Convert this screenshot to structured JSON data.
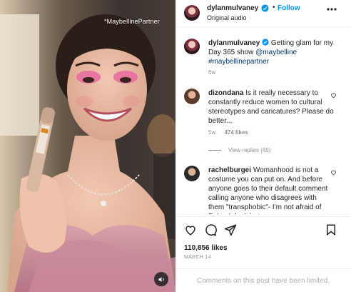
{
  "post": {
    "username": "dylanmulvaney",
    "separator": "•",
    "follow_label": "Follow",
    "audio_label": "Original audio",
    "more_icon": "more-horizontal-icon",
    "verified_icon": "verified-badge-icon"
  },
  "media": {
    "partner_tag": "*MaybellinePartner",
    "audio_icon": "speaker-icon"
  },
  "caption": {
    "username": "dylanmulvaney",
    "text": "Getting glam for my Day 365 show",
    "mention": "@maybelline",
    "hashtag": "#maybellinepartner",
    "time": "6w"
  },
  "comments": [
    {
      "username": "dizondana",
      "text": "Is it really necessary to constantly reduce women to cultural stereotypes and caricatures? Please do better...",
      "time": "5w",
      "likes": "474 likes",
      "view_replies": "View replies (45)"
    },
    {
      "username": "rachelburgei",
      "text": "Womanhood is not a costume you can put on. And before anyone goes to their default comment calling anyone who disagrees with them \"transphobic\"- I'm not afraid of Dylan I don't hate"
    }
  ],
  "actions": {
    "like_icon": "heart-icon",
    "comment_icon": "comment-icon",
    "share_icon": "share-icon",
    "save_icon": "bookmark-icon"
  },
  "stats": {
    "likes": "110,856 likes",
    "date": "MARCH 14"
  },
  "footer": {
    "comments_limited": "Comments on this post have been limited."
  },
  "colors": {
    "accent_blue": "#0095f6",
    "link_blue": "#00376b",
    "muted": "#8e8e8e",
    "dress_pink": "#c98a9a"
  }
}
